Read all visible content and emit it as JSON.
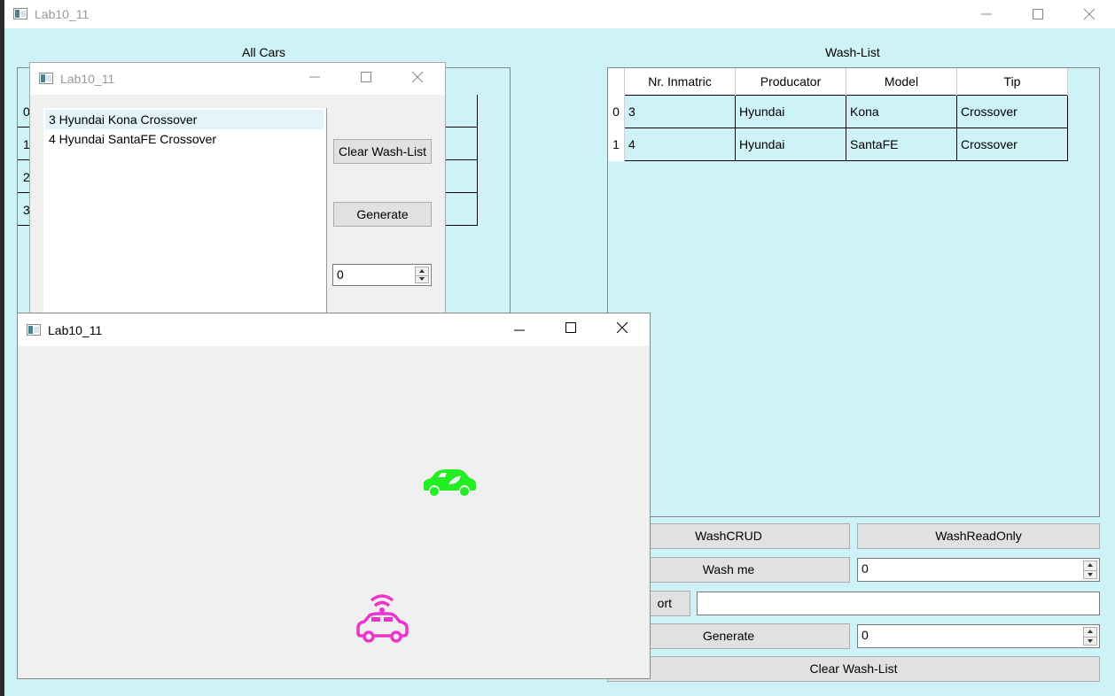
{
  "colors": {
    "app_bg": "#cdf2f8",
    "sub_bg": "#f0f0f0",
    "green_car": "#22ee22",
    "pink_car": "#ee33cc"
  },
  "main_window": {
    "title": "Lab10_11",
    "all_cars_label": "All Cars",
    "all_cars_row_indices": [
      "0",
      "1",
      "2",
      "3"
    ],
    "wash_list_label": "Wash-List",
    "wash_table": {
      "columns": [
        "Nr. Inmatric",
        "Producator",
        "Model",
        "Tip"
      ],
      "rows": [
        {
          "index": "0",
          "cells": [
            "3",
            "Hyundai",
            "Kona",
            "Crossover"
          ]
        },
        {
          "index": "1",
          "cells": [
            "4",
            "Hyundai",
            "SantaFE",
            "Crossover"
          ]
        }
      ]
    },
    "wash_crud_label": "WashCRUD",
    "wash_readonly_label": "WashReadOnly",
    "wash_me_label": "Wash me",
    "wash_me_spin_value": "0",
    "sort_label": "ort",
    "sort_field_value": "",
    "generate_label": "Generate",
    "generate_spin_value": "0",
    "clear_label": "Clear Wash-List"
  },
  "crud_window": {
    "title": "Lab10_11",
    "list_items": [
      "3 Hyundai Kona Crossover",
      "4 Hyundai SantaFE Crossover"
    ],
    "clear_label": "Clear Wash-List",
    "generate_label": "Generate",
    "spin_value": "0"
  },
  "readonly_window": {
    "title": "Lab10_11",
    "car_icons": [
      {
        "name": "green-car-icon",
        "color": "green_car"
      },
      {
        "name": "pink-connected-car-icon",
        "color": "pink_car"
      }
    ]
  }
}
